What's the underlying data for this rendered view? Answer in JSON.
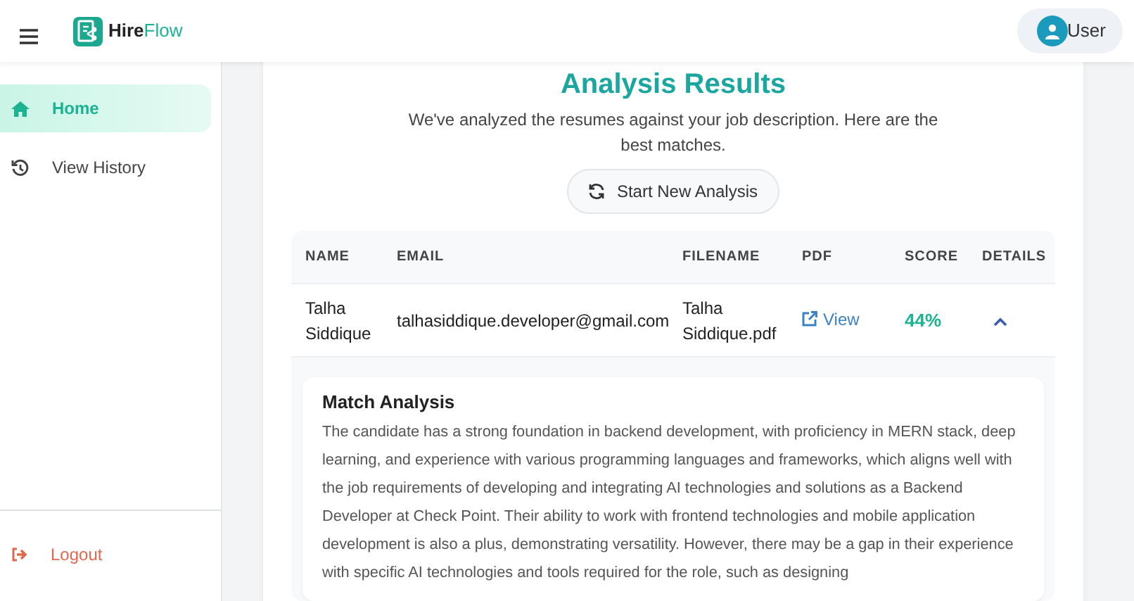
{
  "header": {
    "brand": {
      "first": "Hire",
      "second": "Flow"
    },
    "user": "User"
  },
  "sidebar": {
    "items": [
      {
        "label": "Home",
        "kind": "home",
        "selected": true
      },
      {
        "label": "View History",
        "kind": "history",
        "selected": false
      }
    ],
    "logout": "Logout"
  },
  "results": {
    "title": "Analysis Results",
    "subtitle": "We've analyzed the resumes against your job description. Here are the best matches.",
    "button": "Start New Analysis",
    "table": {
      "columns": [
        "NAME",
        "EMAIL",
        "FILENAME",
        "PDF",
        "SCORE",
        "DETAILS"
      ],
      "rows": [
        {
          "name": "Talha Siddique",
          "email": "talhasiddique.developer@gmail.com",
          "filename": "Talha Siddique.pdf",
          "pdf": "View",
          "score": "44%",
          "expanded": true,
          "analysis": {
            "title": "Match Analysis",
            "text": "The candidate has a strong foundation in backend development, with proficiency in MERN stack, deep learning, and experience with various programming languages and frameworks, which aligns well with the job requirements of developing and integrating AI technologies and solutions as a Backend Developer at Check Point. Their ability to work with frontend technologies and mobile application development is also a plus, demonstrating versatility. However, there may be a gap in their experience with specific AI technologies and tools required for the role, such as designing"
          }
        }
      ]
    }
  }
}
